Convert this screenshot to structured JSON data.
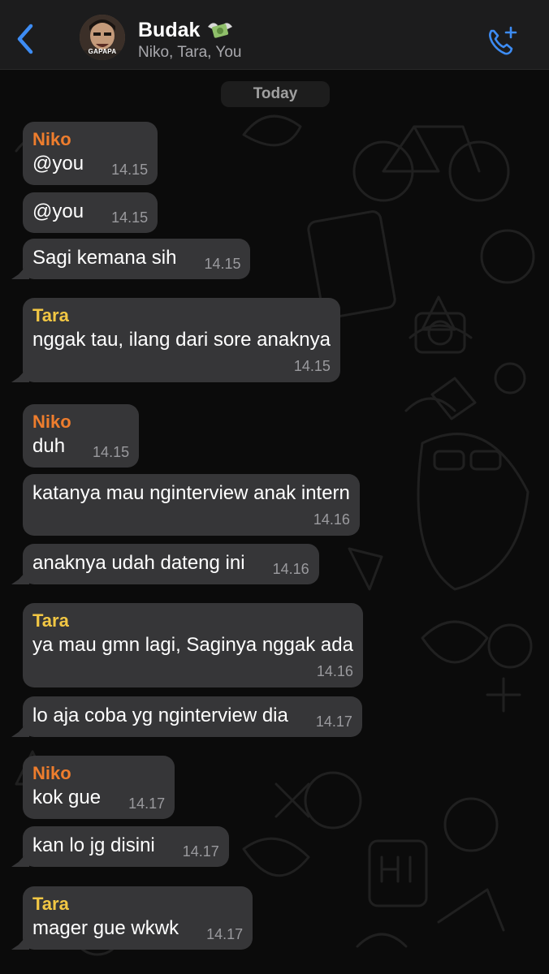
{
  "header": {
    "back_icon": "chevron-left-icon",
    "avatar_tag": "GAPAPA",
    "title": "Budak",
    "title_emoji": "money-with-wings-icon",
    "subtitle": "Niko, Tara, You",
    "call_icon": "add-call-icon",
    "accent_color": "#3d8cf4"
  },
  "chat": {
    "date_label": "Today",
    "sender_colors": {
      "Niko": "#ee7d2d",
      "Tara": "#f2c744"
    },
    "messages": [
      {
        "sender": "Niko",
        "text": "@you",
        "time": "14.15"
      },
      {
        "sender": "",
        "text": "@you",
        "time": "14.15"
      },
      {
        "sender": "",
        "text": "Sagi kemana sih",
        "time": "14.15"
      },
      {
        "sender": "Tara",
        "text": "nggak tau, ilang dari sore anaknya",
        "time": "14.15"
      },
      {
        "sender": "Niko",
        "text": "duh",
        "time": "14.15"
      },
      {
        "sender": "",
        "text": "katanya mau nginterview anak intern",
        "time": "14.16"
      },
      {
        "sender": "",
        "text": "anaknya udah dateng ini",
        "time": "14.16"
      },
      {
        "sender": "Tara",
        "text": "ya mau gmn lagi, Saginya nggak ada",
        "time": "14.16"
      },
      {
        "sender": "",
        "text": "lo aja coba yg nginterview dia",
        "time": "14.17"
      },
      {
        "sender": "Niko",
        "text": "kok gue",
        "time": "14.17"
      },
      {
        "sender": "",
        "text": "kan lo jg disini",
        "time": "14.17"
      },
      {
        "sender": "Tara",
        "text": "mager gue wkwk",
        "time": "14.17"
      }
    ]
  }
}
